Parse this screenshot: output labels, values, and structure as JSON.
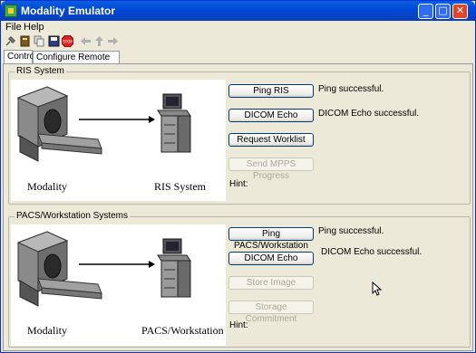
{
  "window": {
    "title": "Modality Emulator"
  },
  "menu": {
    "file": "File",
    "help": "Help"
  },
  "toolbar": {
    "icons": [
      "config-icon",
      "book-icon",
      "copy-icon",
      "save-icon",
      "stop-icon",
      "back-arrow-icon",
      "up-arrow-icon",
      "forward-arrow-icon"
    ],
    "stop_label": "STOP"
  },
  "tabs": {
    "control": "Control",
    "configure": "Configure Remote Systems"
  },
  "ris": {
    "group_label": "RIS System",
    "left_caption": "Modality",
    "right_caption": "RIS System",
    "buttons": {
      "ping": "Ping RIS",
      "echo": "DICOM Echo",
      "worklist": "Request Worklist",
      "mpps": "Send MPPS Progress"
    },
    "status": {
      "ping": "Ping successful.",
      "echo": "DICOM Echo successful."
    },
    "hint": "Hint:"
  },
  "pacs": {
    "group_label": "PACS/Workstation Systems",
    "left_caption": "Modality",
    "right_caption": "PACS/Workstation",
    "buttons": {
      "ping": "Ping PACS/Workstation",
      "echo": "DICOM Echo",
      "store": "Store Image",
      "commit": "Storage Commitment"
    },
    "status": {
      "ping": "Ping successful.",
      "echo": "DICOM Echo successful."
    },
    "hint": "Hint:"
  },
  "colors": {
    "title_bar": "#0047d6",
    "disabled_text": "#aca899",
    "close_button": "#e0452a"
  }
}
